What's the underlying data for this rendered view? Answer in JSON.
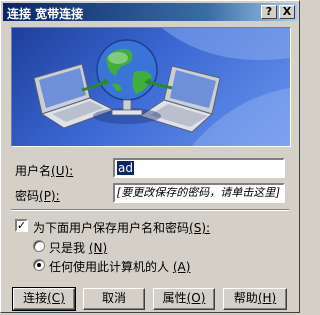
{
  "window": {
    "title": "连接 宽带连接",
    "help_button": "?",
    "close_button": "X"
  },
  "form": {
    "username_label": "用户名",
    "username_hotkey": "(U):",
    "username_value": "ad",
    "password_label": "密码",
    "password_hotkey": "(P):",
    "password_placeholder": "[要更改保存的密码，请单击这里]",
    "save_checkbox_label": "为下面用户保存用户名和密码",
    "save_checkbox_hotkey": "(S):",
    "save_checked": true,
    "radio_me_only": "只是我",
    "radio_me_only_hotkey": "(N)",
    "radio_anyone": "任何使用此计算机的人",
    "radio_anyone_hotkey": "(A)",
    "selected_radio": "anyone"
  },
  "buttons": {
    "connect": "连接",
    "connect_hotkey": "(C)",
    "cancel": "取消",
    "properties": "属性",
    "properties_hotkey": "(O)",
    "help": "帮助",
    "help_hotkey": "(H)"
  },
  "icons": {
    "banner": "network-connection-illustration",
    "globe": "globe-icon",
    "laptop": "laptop-icon"
  },
  "colors": {
    "titlebar_start": "#0a246a",
    "titlebar_end": "#a6caf0",
    "dialog_bg": "#d4d0c8",
    "banner_blue": "#3b68d4"
  }
}
